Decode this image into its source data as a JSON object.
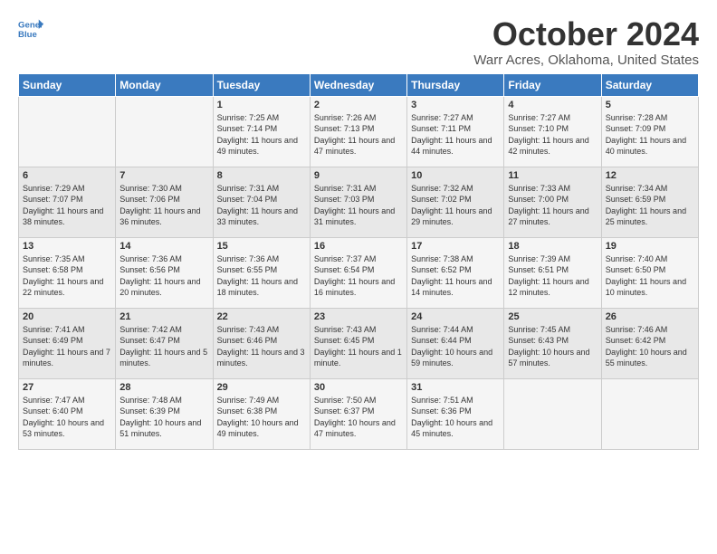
{
  "logo": {
    "line1": "General",
    "line2": "Blue"
  },
  "title": "October 2024",
  "subtitle": "Warr Acres, Oklahoma, United States",
  "days_of_week": [
    "Sunday",
    "Monday",
    "Tuesday",
    "Wednesday",
    "Thursday",
    "Friday",
    "Saturday"
  ],
  "weeks": [
    [
      {
        "day": "",
        "info": ""
      },
      {
        "day": "",
        "info": ""
      },
      {
        "day": "1",
        "info": "Sunrise: 7:25 AM\nSunset: 7:14 PM\nDaylight: 11 hours and 49 minutes."
      },
      {
        "day": "2",
        "info": "Sunrise: 7:26 AM\nSunset: 7:13 PM\nDaylight: 11 hours and 47 minutes."
      },
      {
        "day": "3",
        "info": "Sunrise: 7:27 AM\nSunset: 7:11 PM\nDaylight: 11 hours and 44 minutes."
      },
      {
        "day": "4",
        "info": "Sunrise: 7:27 AM\nSunset: 7:10 PM\nDaylight: 11 hours and 42 minutes."
      },
      {
        "day": "5",
        "info": "Sunrise: 7:28 AM\nSunset: 7:09 PM\nDaylight: 11 hours and 40 minutes."
      }
    ],
    [
      {
        "day": "6",
        "info": "Sunrise: 7:29 AM\nSunset: 7:07 PM\nDaylight: 11 hours and 38 minutes."
      },
      {
        "day": "7",
        "info": "Sunrise: 7:30 AM\nSunset: 7:06 PM\nDaylight: 11 hours and 36 minutes."
      },
      {
        "day": "8",
        "info": "Sunrise: 7:31 AM\nSunset: 7:04 PM\nDaylight: 11 hours and 33 minutes."
      },
      {
        "day": "9",
        "info": "Sunrise: 7:31 AM\nSunset: 7:03 PM\nDaylight: 11 hours and 31 minutes."
      },
      {
        "day": "10",
        "info": "Sunrise: 7:32 AM\nSunset: 7:02 PM\nDaylight: 11 hours and 29 minutes."
      },
      {
        "day": "11",
        "info": "Sunrise: 7:33 AM\nSunset: 7:00 PM\nDaylight: 11 hours and 27 minutes."
      },
      {
        "day": "12",
        "info": "Sunrise: 7:34 AM\nSunset: 6:59 PM\nDaylight: 11 hours and 25 minutes."
      }
    ],
    [
      {
        "day": "13",
        "info": "Sunrise: 7:35 AM\nSunset: 6:58 PM\nDaylight: 11 hours and 22 minutes."
      },
      {
        "day": "14",
        "info": "Sunrise: 7:36 AM\nSunset: 6:56 PM\nDaylight: 11 hours and 20 minutes."
      },
      {
        "day": "15",
        "info": "Sunrise: 7:36 AM\nSunset: 6:55 PM\nDaylight: 11 hours and 18 minutes."
      },
      {
        "day": "16",
        "info": "Sunrise: 7:37 AM\nSunset: 6:54 PM\nDaylight: 11 hours and 16 minutes."
      },
      {
        "day": "17",
        "info": "Sunrise: 7:38 AM\nSunset: 6:52 PM\nDaylight: 11 hours and 14 minutes."
      },
      {
        "day": "18",
        "info": "Sunrise: 7:39 AM\nSunset: 6:51 PM\nDaylight: 11 hours and 12 minutes."
      },
      {
        "day": "19",
        "info": "Sunrise: 7:40 AM\nSunset: 6:50 PM\nDaylight: 11 hours and 10 minutes."
      }
    ],
    [
      {
        "day": "20",
        "info": "Sunrise: 7:41 AM\nSunset: 6:49 PM\nDaylight: 11 hours and 7 minutes."
      },
      {
        "day": "21",
        "info": "Sunrise: 7:42 AM\nSunset: 6:47 PM\nDaylight: 11 hours and 5 minutes."
      },
      {
        "day": "22",
        "info": "Sunrise: 7:43 AM\nSunset: 6:46 PM\nDaylight: 11 hours and 3 minutes."
      },
      {
        "day": "23",
        "info": "Sunrise: 7:43 AM\nSunset: 6:45 PM\nDaylight: 11 hours and 1 minute."
      },
      {
        "day": "24",
        "info": "Sunrise: 7:44 AM\nSunset: 6:44 PM\nDaylight: 10 hours and 59 minutes."
      },
      {
        "day": "25",
        "info": "Sunrise: 7:45 AM\nSunset: 6:43 PM\nDaylight: 10 hours and 57 minutes."
      },
      {
        "day": "26",
        "info": "Sunrise: 7:46 AM\nSunset: 6:42 PM\nDaylight: 10 hours and 55 minutes."
      }
    ],
    [
      {
        "day": "27",
        "info": "Sunrise: 7:47 AM\nSunset: 6:40 PM\nDaylight: 10 hours and 53 minutes."
      },
      {
        "day": "28",
        "info": "Sunrise: 7:48 AM\nSunset: 6:39 PM\nDaylight: 10 hours and 51 minutes."
      },
      {
        "day": "29",
        "info": "Sunrise: 7:49 AM\nSunset: 6:38 PM\nDaylight: 10 hours and 49 minutes."
      },
      {
        "day": "30",
        "info": "Sunrise: 7:50 AM\nSunset: 6:37 PM\nDaylight: 10 hours and 47 minutes."
      },
      {
        "day": "31",
        "info": "Sunrise: 7:51 AM\nSunset: 6:36 PM\nDaylight: 10 hours and 45 minutes."
      },
      {
        "day": "",
        "info": ""
      },
      {
        "day": "",
        "info": ""
      }
    ]
  ]
}
